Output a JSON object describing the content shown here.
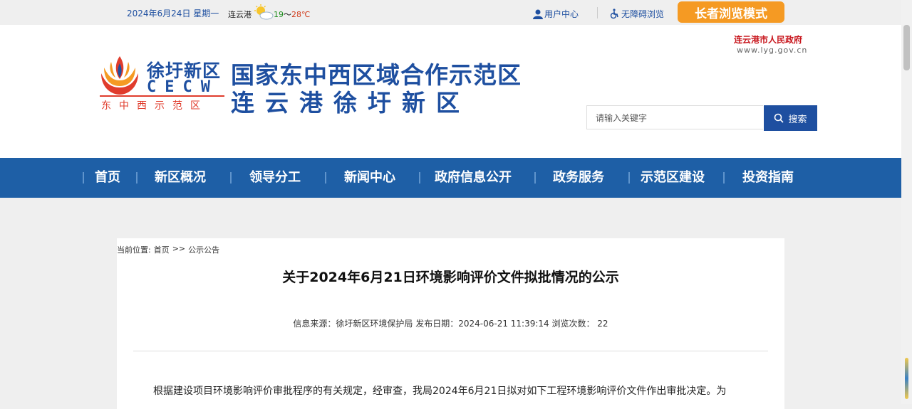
{
  "topbar": {
    "date": "2024年6月24日 星期一",
    "city": "连云港",
    "weather_icon": "sun-cloud-icon",
    "temp_low": "19",
    "temp_sep": "～",
    "temp_high": "28℃",
    "user_center": "用户中心",
    "accessibility": "无障碍浏览",
    "elder_mode": "长者浏览模式"
  },
  "header": {
    "logo_cn": "徐圩新区",
    "logo_en": "CECW",
    "logo_sub": "东中西示范区",
    "title_line1": "国家东中西区域合作示范区",
    "title_line2": "连云港徐圩新区",
    "gov_name": "连云港市人民政府",
    "gov_url": "www.lyg.gov.cn",
    "search_placeholder": "请输入关键字",
    "search_button": "搜索"
  },
  "nav": {
    "items": [
      {
        "label": "首页"
      },
      {
        "label": "新区概况"
      },
      {
        "label": "领导分工"
      },
      {
        "label": "新闻中心"
      },
      {
        "label": "政府信息公开"
      },
      {
        "label": "政务服务"
      },
      {
        "label": "示范区建设"
      },
      {
        "label": "投资指南"
      }
    ]
  },
  "breadcrumb": {
    "prefix": "当前位置:",
    "home": "首页",
    "sep": ">>",
    "current": "公示公告"
  },
  "article": {
    "title": "关于2024年6月21日环境影响评价文件拟批情况的公示",
    "meta": "信息来源：徐圩新区环境保护局 发布日期：2024-06-21 11:39:14 浏览次数： 22",
    "body": "根据建设项目环境影响评价审批程序的有关规定，经审查，我局2024年6月21日拟对如下工程环境影响评价文件作出审批决定。为"
  },
  "colors": {
    "brand_blue": "#1e4fa0",
    "nav_blue": "#1e5fa6",
    "elder_orange": "#f59a23",
    "gov_red": "#c8161d"
  }
}
